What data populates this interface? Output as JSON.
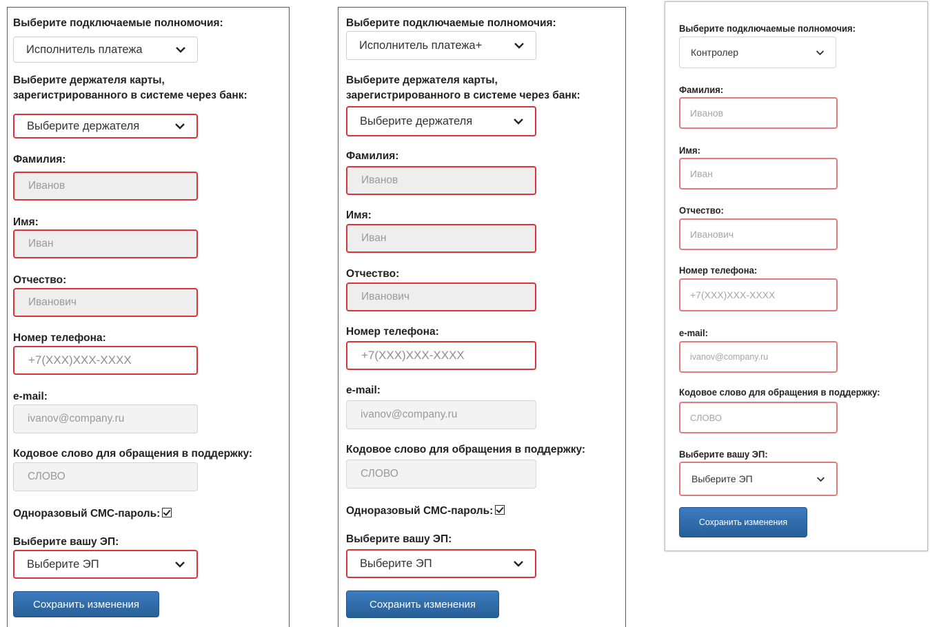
{
  "forms": [
    {
      "role_label": "Выберите подключаемые полномочия:",
      "role_value": "Исполнитель платежа",
      "holder_label_line1": "Выберите держателя карты,",
      "holder_label_line2": "зарегистрированного в системе через банк:",
      "holder_value": "Выберите держателя",
      "surname_label": "Фамилия:",
      "surname_value": "Иванов",
      "name_label": "Имя:",
      "name_value": "Иван",
      "patronymic_label": "Отчество:",
      "patronymic_value": "Иванович",
      "phone_label": "Номер телефона:",
      "phone_value": "+7(XXX)XXX-XXXX",
      "email_label": "e-mail:",
      "email_value": "ivanov@company.ru",
      "codeword_label": "Кодовое слово для обращения в поддержку:",
      "codeword_value": "СЛОВО",
      "sms_label": "Одноразовый СМС-пароль:",
      "ep_label": "Выберите вашу ЭП:",
      "ep_value": "Выберите ЭП",
      "save_label": "Сохранить изменения"
    },
    {
      "role_label": "Выберите подключаемые полномочия:",
      "role_value": "Исполнитель платежа+",
      "holder_label_line1": "Выберите держателя карты,",
      "holder_label_line2": "зарегистрированного в системе через банк:",
      "holder_value": "Выберите держателя",
      "surname_label": "Фамилия:",
      "surname_value": "Иванов",
      "name_label": "Имя:",
      "name_value": "Иван",
      "patronymic_label": "Отчество:",
      "patronymic_value": "Иванович",
      "phone_label": "Номер телефона:",
      "phone_value": "+7(XXX)XXX-XXXX",
      "email_label": "e-mail:",
      "email_value": "ivanov@company.ru",
      "codeword_label": "Кодовое слово для обращения в поддержку:",
      "codeword_value": "СЛОВО",
      "sms_label": "Одноразовый СМС-пароль:",
      "ep_label": "Выберите вашу ЭП:",
      "ep_value": "Выберите ЭП",
      "save_label": "Сохранить изменения"
    },
    {
      "role_label": "Выберите подключаемые полномочия:",
      "role_value": "Контролер",
      "surname_label": "Фамилия:",
      "surname_value": "Иванов",
      "name_label": "Имя:",
      "name_value": "Иван",
      "patronymic_label": "Отчество:",
      "patronymic_value": "Иванович",
      "phone_label": "Номер телефона:",
      "phone_value": "+7(XXX)XXX-XXXX",
      "email_label": "e-mail:",
      "email_value": "ivanov@company.ru",
      "codeword_label": "Кодовое слово для обращения в поддержку:",
      "codeword_value": "СЛОВО",
      "ep_label": "Выберите вашу ЭП:",
      "ep_value": "Выберите ЭП",
      "save_label": "Сохранить изменения"
    }
  ],
  "sms_checked": true,
  "icons": {
    "select_arrow": "chevron-down-icon",
    "sms_checkbox": "checkbox-checked-icon"
  },
  "colors": {
    "required_border": "#d8343a",
    "required_border_light": "#e47a7e",
    "disabled_field_bg": "#eeeeee",
    "button_blue": "#2f6ea9"
  }
}
